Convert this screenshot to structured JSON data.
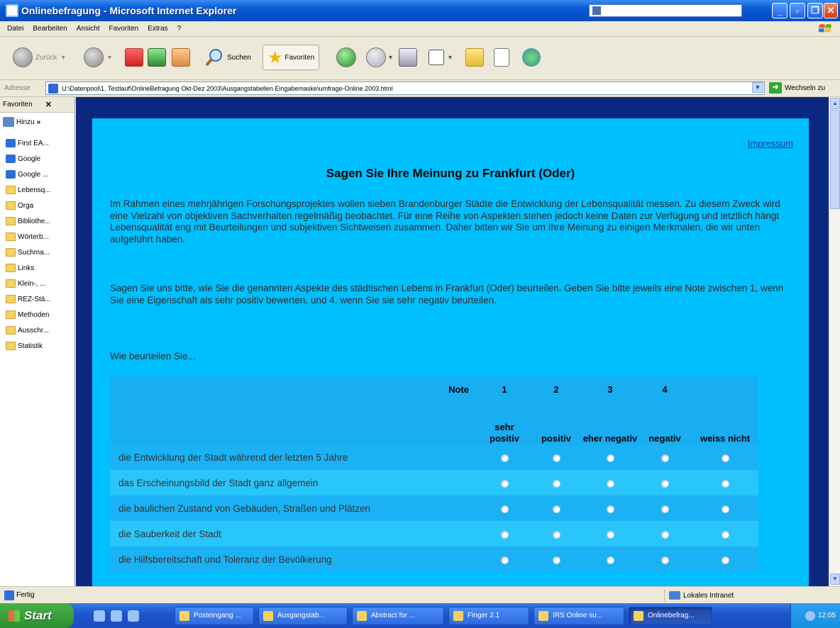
{
  "window": {
    "title": "Onlinebefragung - Microsoft Internet Explorer"
  },
  "menu": [
    "Datei",
    "Bearbeiten",
    "Ansicht",
    "Favoriten",
    "Extras",
    "?"
  ],
  "toolbar": {
    "back": "Zurück",
    "search": "Suchen",
    "favorites": "Favoriten"
  },
  "address": {
    "label": "Adresse",
    "url": "U:\\Datenpool\\1. Testlauf\\OnlineBefragung Okt-Dez 2003\\Ausgangstabellen Eingabemaske\\umfrage-Online 2003.html",
    "go": "Wechseln zu"
  },
  "favorites_panel": {
    "title": "Favoriten",
    "add": "Hinzu",
    "items": [
      {
        "label": "First EA...",
        "type": "page"
      },
      {
        "label": "Google",
        "type": "page"
      },
      {
        "label": "Google ...",
        "type": "page"
      },
      {
        "label": "Lebensq...",
        "type": "folder"
      },
      {
        "label": "Orga",
        "type": "folder"
      },
      {
        "label": "Bibliothe...",
        "type": "folder"
      },
      {
        "label": "Wörterb...",
        "type": "folder"
      },
      {
        "label": "Suchma...",
        "type": "folder"
      },
      {
        "label": "Links",
        "type": "folder"
      },
      {
        "label": "Klein-, ...",
        "type": "folder"
      },
      {
        "label": "REZ-Stä...",
        "type": "folder"
      },
      {
        "label": "Methoden",
        "type": "folder"
      },
      {
        "label": "Ausschr...",
        "type": "folder"
      },
      {
        "label": "Statistik",
        "type": "folder"
      }
    ]
  },
  "page": {
    "impressum": "Impressum",
    "heading": "Sagen Sie Ihre Meinung zu Frankfurt (Oder)",
    "intro": "Im Rahmen eines mehrjährigen Forschungsprojektes wollen sieben Brandenburger Städte die Entwicklung der Lebensqualität messen. Zu diesem Zweck wird eine Vielzahl von objektiven Sachverhalten regelmäßig beobachtet. Für eine Reihe von Aspekten stehen jedoch keine Daten zur Verfügung und letztlich hängt Lebensqualität eng mit Beurteilungen und subjektiven Sichtweisen zusammen. Daher bitten wir Sie um Ihre Meinung zu einigen Merkmalen, die wir unten aufgeführt haben.",
    "instructions": "Sagen Sie uns bitte, wie Sie die genannten Aspekte des städtischen Lebens in Frankfurt (Oder) beurteilen. Geben Sie bitte jeweils eine Note zwischen 1, wenn Sie eine Eigenschaft als sehr positiv bewerten, und 4, wenn Sie sie sehr negativ beurteilen.",
    "lead": "Wie beurteilen Sie...",
    "table": {
      "note_label": "Note",
      "grades": [
        "1",
        "2",
        "3",
        "4",
        ""
      ],
      "columns": [
        "sehr positiv",
        "positiv",
        "eher negativ",
        "negativ",
        "weiss nicht"
      ],
      "rows": [
        "die Entwicklung der Stadt während der letzten 5 Jahre",
        "das Erscheinungsbild der Stadt ganz allgemein",
        "die baulichen Zustand von Gebäuden, Straßen und Plätzen",
        "die Sauberkeit der Stadt",
        "die Hilfsbereitschaft und Toleranz der Bevölkerung"
      ]
    }
  },
  "status": {
    "text": "Fertig",
    "zone": "Lokales Intranet"
  },
  "taskbar": {
    "start": "Start",
    "tasks": [
      "Posteingang ...",
      "Ausgangstab...",
      "Abstract for ...",
      "Finger 2.1",
      "IRS Online su...",
      "Onlinebefrag..."
    ],
    "clock": "12:05"
  }
}
